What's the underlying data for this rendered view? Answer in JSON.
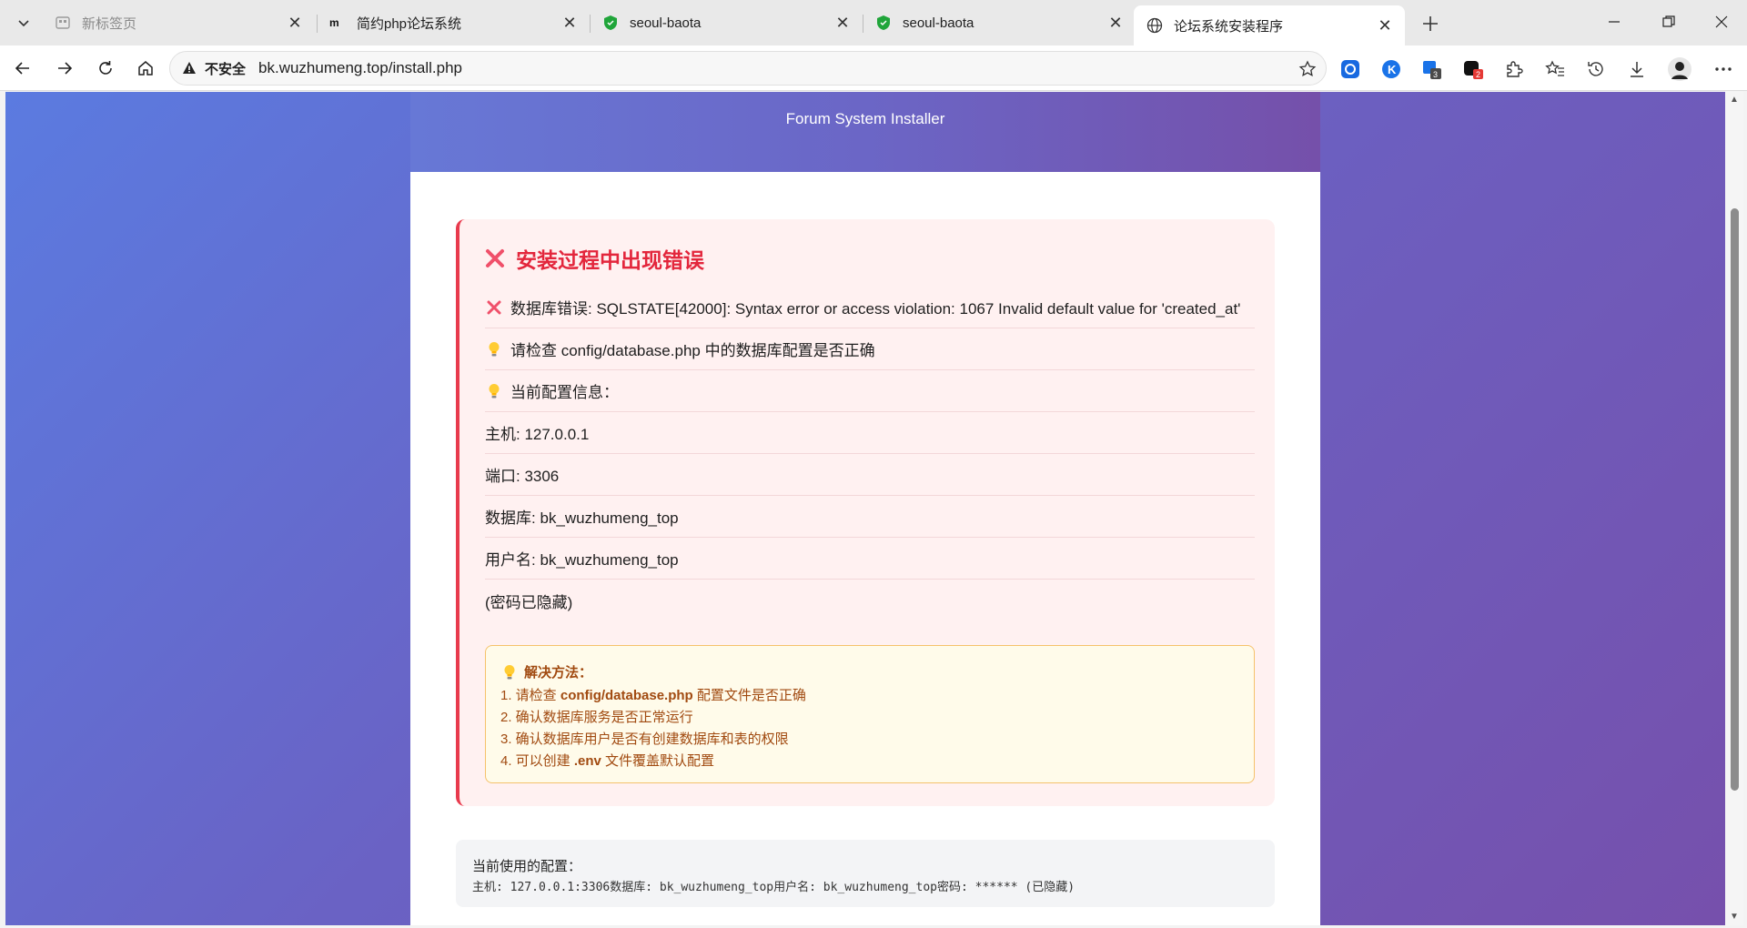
{
  "browser": {
    "tabs": [
      {
        "title": "新标签页",
        "icon": "new-tab-page-icon",
        "dim": true
      },
      {
        "title": "简约php论坛系统",
        "icon": "site-logo-icon",
        "dim": false
      },
      {
        "title": "seoul-baota",
        "icon": "shield-icon",
        "dim": false
      },
      {
        "title": "seoul-baota",
        "icon": "shield-icon",
        "dim": false
      },
      {
        "title": "论坛系统安装程序",
        "icon": "globe-icon",
        "dim": false,
        "active": true
      }
    ],
    "address": {
      "security_label": "不安全",
      "url": "bk.wuzhumeng.top/install.php"
    },
    "extension_badges": {
      "ext3": "3",
      "ext4": "2"
    }
  },
  "page": {
    "header_subtitle": "Forum System Installer",
    "error": {
      "title": "安装过程中出现错误",
      "lines": [
        {
          "icon": "x-icon",
          "text": "数据库错误: SQLSTATE[42000]: Syntax error or access violation: 1067 Invalid default value for 'created_at'"
        },
        {
          "icon": "bulb-icon",
          "text": "请检查 config/database.php 中的数据库配置是否正确"
        },
        {
          "icon": "bulb-icon",
          "text": "当前配置信息："
        },
        {
          "icon": "",
          "text": "主机: 127.0.0.1"
        },
        {
          "icon": "",
          "text": "端口: 3306"
        },
        {
          "icon": "",
          "text": "数据库: bk_wuzhumeng_top"
        },
        {
          "icon": "",
          "text": "用户名: bk_wuzhumeng_top"
        },
        {
          "icon": "",
          "text": "(密码已隐藏)"
        }
      ]
    },
    "solution": {
      "title": "解决方法：",
      "items": [
        {
          "prefix": "1. 请检查 ",
          "strong": "config/database.php",
          "suffix": " 配置文件是否正确"
        },
        {
          "prefix": "2. 确认数据库服务是否正常运行",
          "strong": "",
          "suffix": ""
        },
        {
          "prefix": "3. 确认数据库用户是否有创建数据库和表的权限",
          "strong": "",
          "suffix": ""
        },
        {
          "prefix": "4. 可以创建 ",
          "strong": ".env",
          "suffix": " 文件覆盖默认配置"
        }
      ]
    },
    "config": {
      "title": "当前使用的配置：",
      "line": "主机: 127.0.0.1:3306数据库: bk_wuzhumeng_top用户名: bk_wuzhumeng_top密码: ****** (已隐藏)"
    }
  },
  "colors": {
    "error_accent": "#e83a4d",
    "header_gradient_start": "#6778d6",
    "header_gradient_end": "#7550aa",
    "solution_text": "#a14a10"
  }
}
